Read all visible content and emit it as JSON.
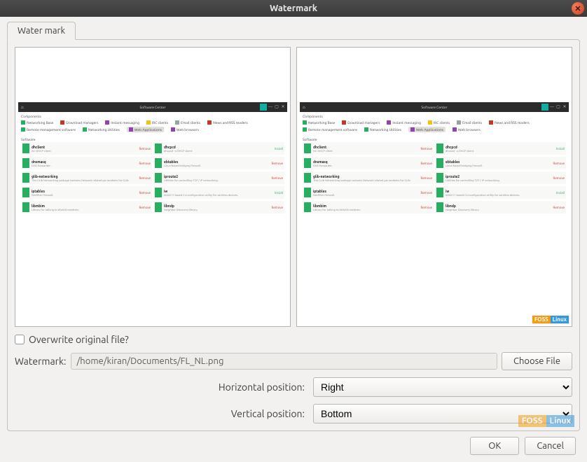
{
  "window": {
    "title": "Watermark"
  },
  "tab": {
    "label": "Water mark"
  },
  "preview": {
    "app_title": "Software Center",
    "sect_components": "Components",
    "sect_software": "Software",
    "tags": [
      {
        "label": "Networking Base",
        "color": "#27ae60"
      },
      {
        "label": "Download managers",
        "color": "#c0392b"
      },
      {
        "label": "Instant messaging",
        "color": "#8e44ad"
      },
      {
        "label": "IRC clients",
        "color": "#f1c40f"
      },
      {
        "label": "Email clients",
        "color": "#95a5a6"
      },
      {
        "label": "News and RSS readers",
        "color": "#c0392b"
      },
      {
        "label": "Remote management software",
        "color": "#27ae60"
      },
      {
        "label": "Networking Utilities",
        "color": "#27ae60"
      },
      {
        "label": "Web Applications",
        "color": "#8e44ad",
        "selected": true
      },
      {
        "label": "Web browsers",
        "color": "#8e44ad"
      }
    ],
    "software_rows": [
      [
        {
          "name": "dhclient",
          "desc": "ISC DHCP client",
          "color": "#27ae60",
          "action": "Remove"
        },
        {
          "name": "dhcpcd",
          "desc": "dhcpcd - a DHCP client",
          "color": "#27ae60",
          "action": "Install"
        }
      ],
      [
        {
          "name": "dnsmasq",
          "desc": "DNS forwarder.",
          "color": "#27ae60",
          "action": "Remove"
        },
        {
          "name": "ebtables",
          "desc": "Linux-based bridging firewall.",
          "color": "#27ae60",
          "action": "Remove"
        }
      ],
      [
        {
          "name": "glib-networking",
          "desc": "This GLib Networking package contains Network related gio modules for GLib.",
          "color": "#27ae60",
          "action": "Remove"
        },
        {
          "name": "iproute2",
          "desc": "Utilities for controlling TCP / IP networking.",
          "color": "#27ae60",
          "action": "Remove"
        }
      ],
      [
        {
          "name": "iptables",
          "desc": "Netfilter firewall.",
          "color": "#27ae60",
          "action": "Remove"
        },
        {
          "name": "iw",
          "desc": "nl80211 based CLI configuration utility for wireless devices.",
          "color": "#27ae60",
          "action": "Install"
        }
      ],
      [
        {
          "name": "libmbim",
          "desc": "Library for talking to WWAN modems.",
          "color": "#27ae60",
          "action": "Remove"
        },
        {
          "name": "libndp",
          "desc": "Neighbor Discovery library.",
          "color": "#27ae60",
          "action": "Remove"
        }
      ]
    ],
    "wm": {
      "a": "FOSS",
      "b": "Linux"
    }
  },
  "controls": {
    "overwrite_label": "Overwrite original file?",
    "watermark_label": "Watermark:",
    "watermark_path": "/home/kiran/Documents/FL_NL.png",
    "choose_file": "Choose File",
    "hpos_label": "Horizontal position:",
    "hpos_value": "Right",
    "vpos_label": "Vertical position:",
    "vpos_value": "Bottom"
  },
  "footer": {
    "ok": "OK",
    "cancel": "Cancel"
  }
}
